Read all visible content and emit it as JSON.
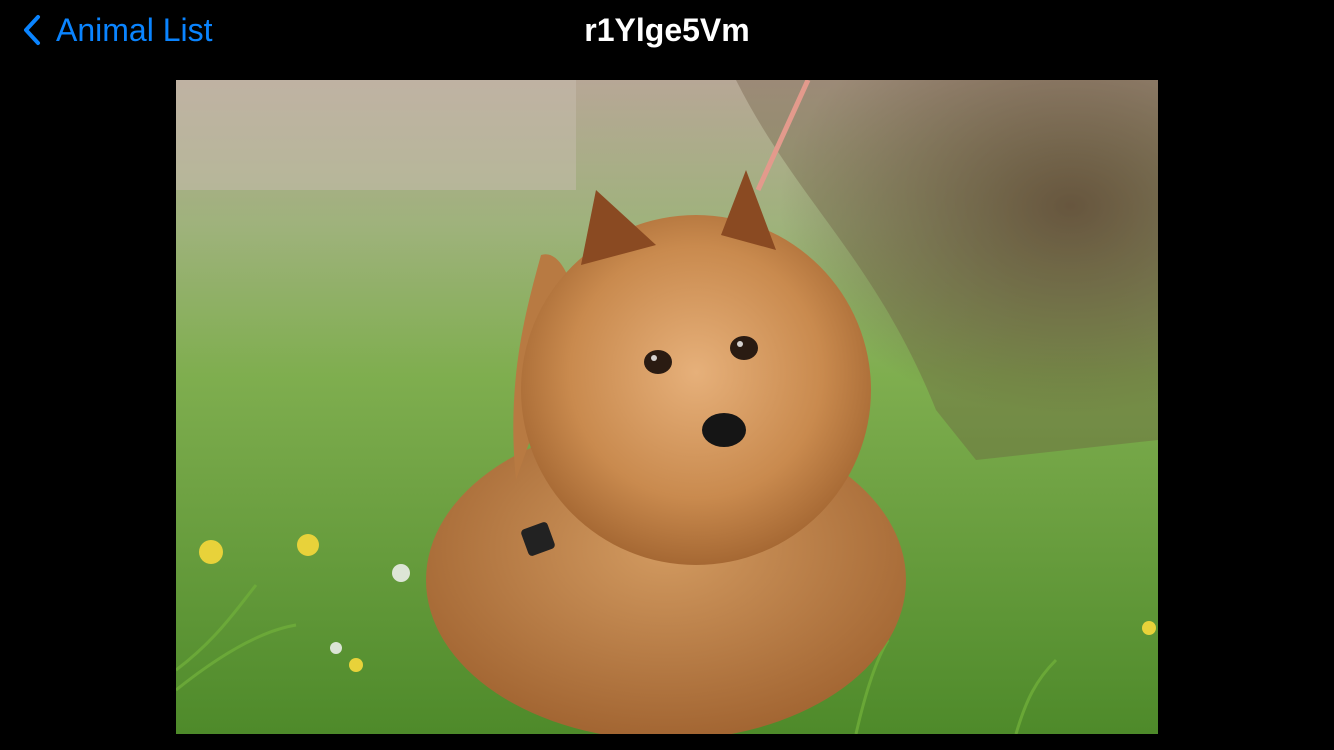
{
  "navbar": {
    "back_label": "Animal List",
    "back_icon": "chevron-left-icon",
    "title": "r1Ylge5Vm"
  },
  "photo": {
    "subject": "dog-photo"
  },
  "colors": {
    "background": "#000000",
    "accent": "#0a84ff",
    "title": "#ffffff"
  }
}
